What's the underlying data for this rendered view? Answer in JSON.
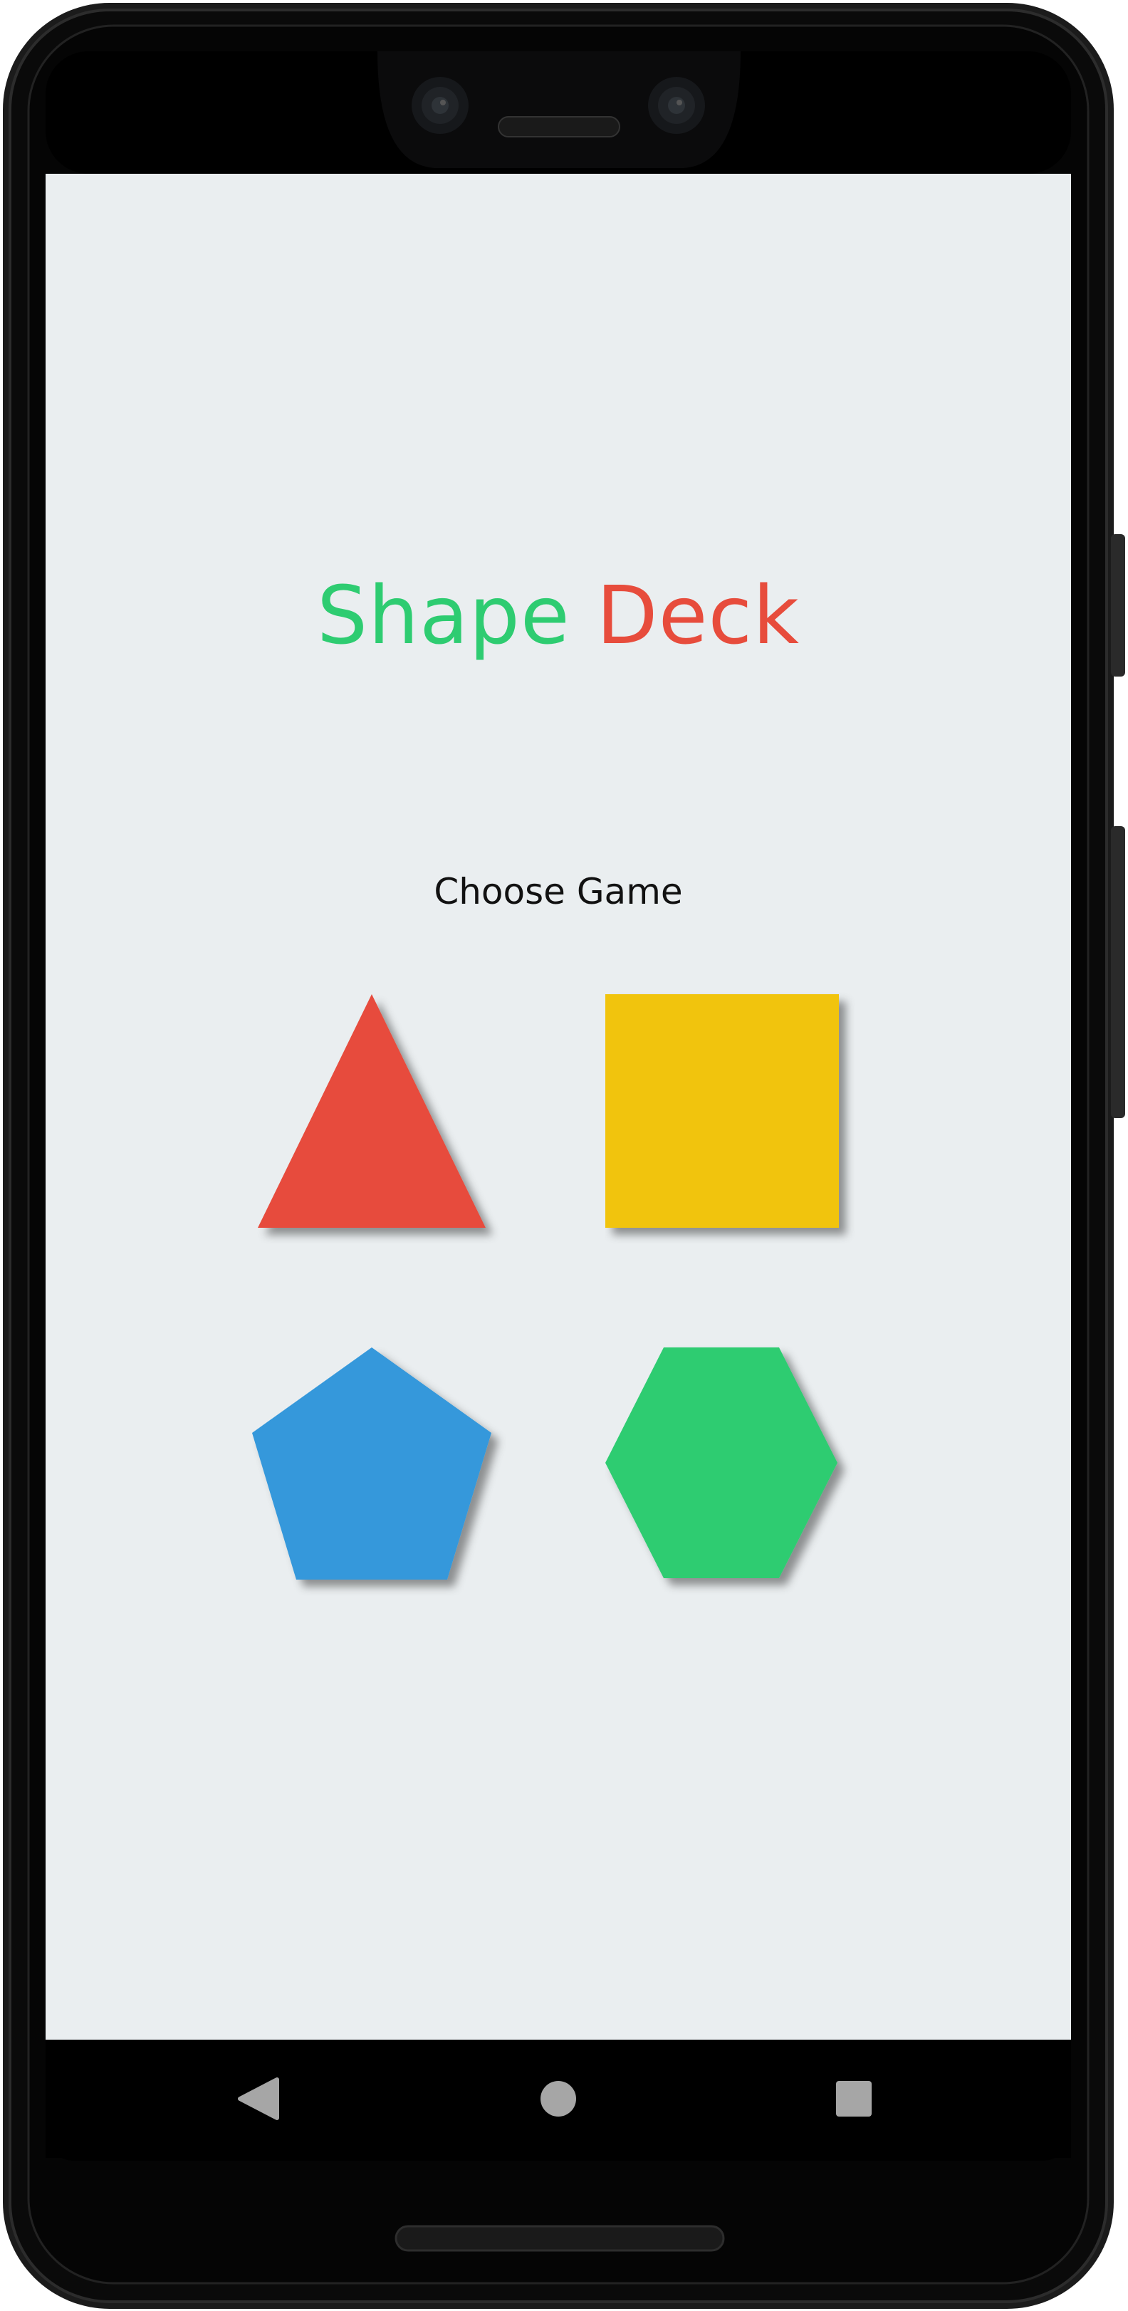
{
  "app": {
    "title_word_1": "Shape",
    "title_word_2": "Deck",
    "subtitle": "Choose Game"
  },
  "games": [
    {
      "shape": "triangle",
      "color": "#e74c3c"
    },
    {
      "shape": "square",
      "color": "#f1c40f"
    },
    {
      "shape": "pentagon",
      "color": "#3498db"
    },
    {
      "shape": "hexagon",
      "color": "#2ecc71"
    }
  ],
  "colors": {
    "background": "#eaeef0",
    "title_green": "#2ecc71",
    "title_red": "#e74c3c",
    "text": "#111111"
  },
  "navbar": {
    "back_icon": "triangle-back-icon",
    "home_icon": "circle-home-icon",
    "recents_icon": "square-recents-icon"
  }
}
